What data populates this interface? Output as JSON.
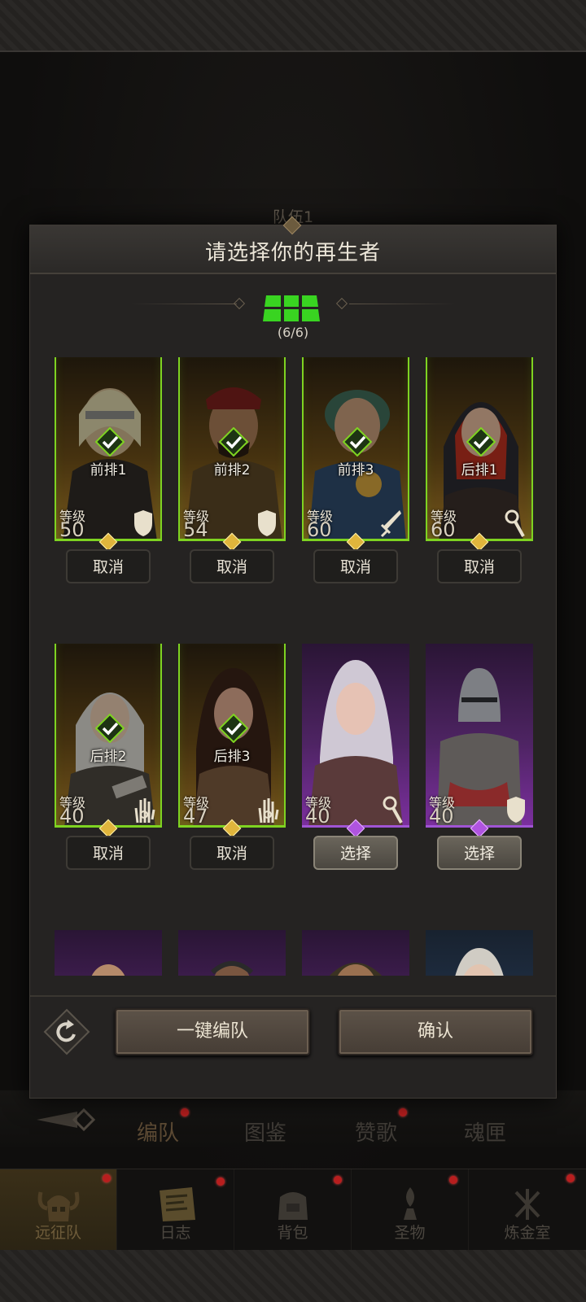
{
  "background": {
    "team_label": "队伍1",
    "tabs": [
      {
        "label": "编队",
        "badge": true
      },
      {
        "label": "图鉴",
        "badge": false
      },
      {
        "label": "赞歌",
        "badge": true
      },
      {
        "label": "魂匣",
        "badge": false
      }
    ],
    "nav": [
      {
        "label": "远征队",
        "icon": "helmet-icon",
        "active": true,
        "badge": true
      },
      {
        "label": "日志",
        "icon": "journal-icon",
        "active": false,
        "badge": true
      },
      {
        "label": "背包",
        "icon": "backpack-icon",
        "active": false,
        "badge": true
      },
      {
        "label": "圣物",
        "icon": "relic-icon",
        "active": false,
        "badge": true
      },
      {
        "label": "炼金室",
        "icon": "alchemy-icon",
        "active": false,
        "badge": true
      }
    ]
  },
  "modal": {
    "title": "请选择你的再生者",
    "formation_count": "(6/6)",
    "confirm_label": "确认",
    "auto_team_label": "一键编队",
    "level_label": "等级",
    "cancel_label": "取消",
    "select_label": "选择"
  },
  "heroes": [
    {
      "level": "50",
      "position": "前排1",
      "selected": true,
      "rarity": "gold",
      "class_icon": "shield-icon"
    },
    {
      "level": "54",
      "position": "前排2",
      "selected": true,
      "rarity": "gold",
      "class_icon": "shield-icon"
    },
    {
      "level": "60",
      "position": "前排3",
      "selected": true,
      "rarity": "gold",
      "class_icon": "sword-icon"
    },
    {
      "level": "60",
      "position": "后排1",
      "selected": true,
      "rarity": "gold",
      "class_icon": "staff-icon"
    },
    {
      "level": "40",
      "position": "后排2",
      "selected": true,
      "rarity": "gold",
      "class_icon": "palm-icon"
    },
    {
      "level": "47",
      "position": "后排3",
      "selected": true,
      "rarity": "gold",
      "class_icon": "palm-icon"
    },
    {
      "level": "40",
      "position": "",
      "selected": false,
      "rarity": "purple",
      "class_icon": "staff-icon"
    },
    {
      "level": "40",
      "position": "",
      "selected": false,
      "rarity": "purple",
      "class_icon": "shield-icon"
    },
    {
      "level": "",
      "position": "",
      "selected": false,
      "rarity": "purple",
      "class_icon": ""
    },
    {
      "level": "",
      "position": "",
      "selected": false,
      "rarity": "purple",
      "class_icon": ""
    },
    {
      "level": "",
      "position": "",
      "selected": false,
      "rarity": "purple",
      "class_icon": ""
    },
    {
      "level": "",
      "position": "",
      "selected": false,
      "rarity": "blue",
      "class_icon": ""
    }
  ],
  "colors": {
    "selected_border": "#7ed321",
    "gold": "#c98c1a",
    "purple": "#a054d4",
    "badge_red": "#b81e1e"
  }
}
